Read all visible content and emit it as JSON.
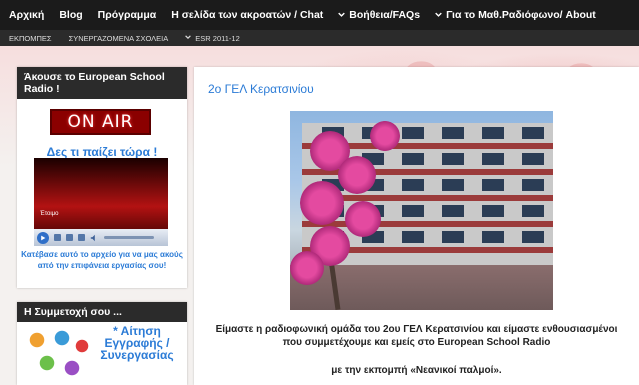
{
  "nav": {
    "items": [
      {
        "label": "Αρχική",
        "dropdown": false
      },
      {
        "label": "Blog",
        "dropdown": false
      },
      {
        "label": "Πρόγραμμα",
        "dropdown": false
      },
      {
        "label": "Η σελίδα των ακροατών / Chat",
        "dropdown": false
      },
      {
        "label": "Βοήθεια/FAQs",
        "dropdown": true
      },
      {
        "label": "Για το Μαθ.Ραδιόφωνο/ About",
        "dropdown": true
      }
    ],
    "sub_items": [
      {
        "label": "ΕΚΠΟΜΠΕΣ",
        "dropdown": false
      },
      {
        "label": "ΣΥΝΕΡΓΑΖΟΜΕΝΑ ΣΧΟΛΕΙΑ",
        "dropdown": false
      },
      {
        "label": "ESR 2011-12",
        "dropdown": true
      }
    ]
  },
  "sidebar": {
    "radio_widget": {
      "title": "Άκουσε το European School Radio !",
      "on_air": "ON AIR",
      "now_playing": "Δες τι παίζει τώρα !",
      "player_label": "Έτοιμο",
      "caption": "Κατέβασε αυτό το αρχείο για να μας ακούς από την επιφάνεια εργασίας σου!"
    },
    "participation_widget": {
      "title": "Η Συμμετοχή σου ...",
      "link": "* Αίτηση Εγγραφής / Συνεργασίας"
    }
  },
  "post": {
    "title": "2ο ΓΕΛ Κερατσινίου",
    "body_line1": "Είμαστε η ραδιοφωνική ομάδα του 2ου ΓΕΛ Κερατσινίου και είμαστε ενθουσιασμένοι",
    "body_line2": "που συμμετέχουμε και εμείς στο European School Radio",
    "show_prefix": "με την εκπομπή «",
    "show_name": "Νεανικοί παλμοί",
    "show_suffix": "»."
  },
  "colors": {
    "nav_bg": "#1b1b1b",
    "subnav_bg": "#2b2b2b",
    "link_blue": "#2b7bd6",
    "on_air_red": "#8b0000"
  },
  "icons": {
    "nav_dropdown": "chevron-down-icon",
    "player_play": "play-icon"
  }
}
